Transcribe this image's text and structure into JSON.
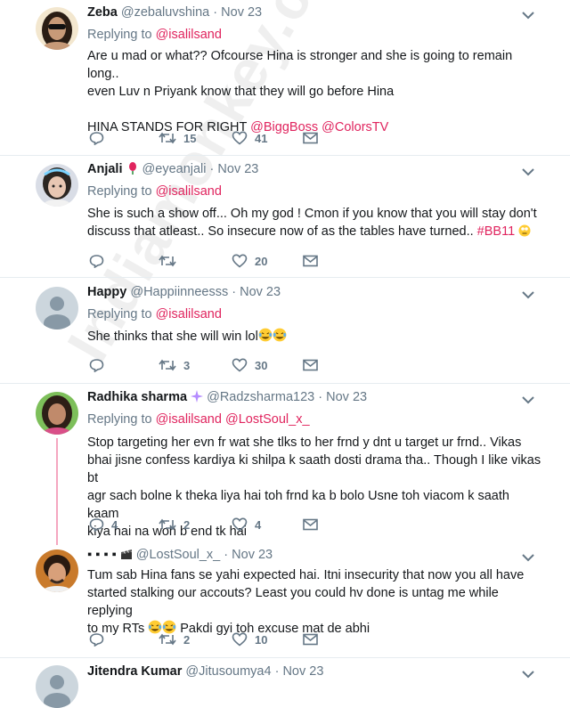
{
  "tweets": [
    {
      "name": "Zeba",
      "handle": "@zebaluvshina",
      "dot": "·",
      "date": "Nov 23",
      "replying_label": "Replying to",
      "replying_to": [
        "@isalilsand"
      ],
      "body_lines": [
        "Are u mad or what?? Ofcourse Hina is stronger and she is going to remain long..",
        "even Luv n Priyank know that they will go before Hina"
      ],
      "body_tail_text": "HINA STANDS FOR RIGHT",
      "body_tail_links": [
        "@BiggBoss",
        "@ColorsTV"
      ],
      "retweets": "15",
      "likes": "41"
    },
    {
      "name": "Anjali",
      "handle": "@eyeanjali",
      "dot": "·",
      "date": "Nov 23",
      "replying_label": "Replying to",
      "replying_to": [
        "@isalilsand"
      ],
      "body_lines": [
        "She is such a show off... Oh my god ! Cmon if you know that you will stay don't",
        "discuss that atleast.. So insecure now of as the tables have turned.."
      ],
      "hashtag": "#BB11",
      "retweets": "",
      "likes": "20"
    },
    {
      "name": "Happy",
      "handle": "@Happiinneesss",
      "dot": "·",
      "date": "Nov 23",
      "replying_label": "Replying to",
      "replying_to": [
        "@isalilsand"
      ],
      "body_lines": [
        "She thinks that she will win lol"
      ],
      "retweets": "3",
      "likes": "30"
    },
    {
      "name": "Radhika sharma",
      "handle": "@Radzsharma123",
      "dot": "·",
      "date": "Nov 23",
      "replying_label": "Replying to",
      "replying_to": [
        "@isalilsand",
        "@LostSoul_x_"
      ],
      "body_lines": [
        "Stop targeting her evn fr wat she tlks to her frnd  y dnt u target ur frnd.. Vikas",
        "bhai jisne confess kardiya ki shilpa k saath dosti drama tha.. Though I like vikas bt",
        "agr sach bolne k theka liya hai toh frnd ka b bolo Usne toh viacom k saath kaam",
        "kiya hai na woh b end tk hai"
      ],
      "replies": "4",
      "retweets": "2",
      "likes": "4"
    },
    {
      "name": "▪ ▪ ▪ ▪",
      "handle": "@LostSoul_x_",
      "dot": "·",
      "date": "Nov 23",
      "body_lines": [
        "Tum sab Hina fans se yahi expected hai. Itni insecurity that now you all have",
        "started stalking our accouts? Least you could hv done is untag me while replying",
        "to my RTs",
        "Pakdi gyi toh excuse mat de abhi"
      ],
      "retweets": "2",
      "likes": "10"
    },
    {
      "name": "Jitendra Kumar",
      "handle": "@Jitusoumya4",
      "dot": "·",
      "date": "Nov 23"
    }
  ],
  "watermark": "Indiamonkey.com",
  "colors": {
    "mention": "#e0245e",
    "meta": "#657786",
    "text": "#14171a",
    "separator": "#e6ecf0",
    "thread": "#f4a6c0"
  }
}
